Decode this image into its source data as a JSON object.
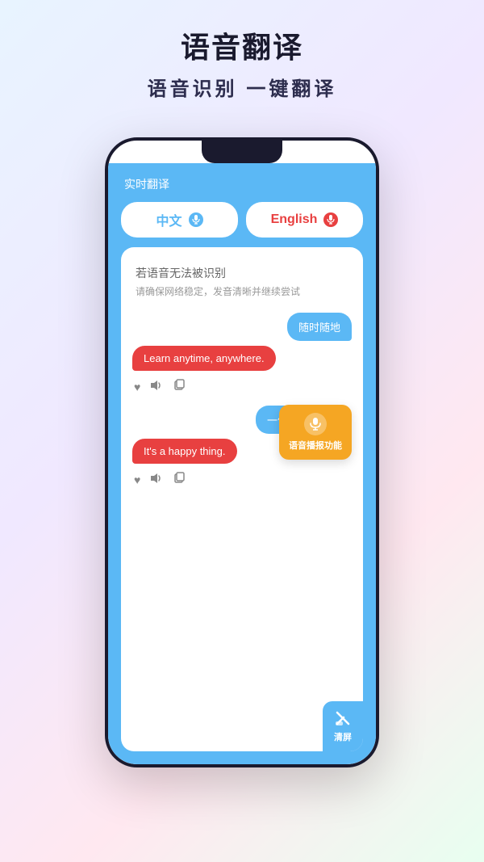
{
  "header": {
    "title": "语音翻译",
    "subtitle": "语音识别 一键翻译"
  },
  "phone": {
    "appTitle": "实时翻译",
    "languages": {
      "chinese": "中文",
      "english": "English"
    },
    "statusMessage": {
      "title": "若语音无法被识别",
      "subtitle": "请确保网络稳定，发音清晰并继续尝试"
    },
    "conversations": [
      {
        "rightBubble": "随时随地",
        "leftBubble": "Learn anytime, anywhere."
      },
      {
        "rightBubble": "一件快乐的事。",
        "leftBubble": "It's a happy thing."
      }
    ],
    "tooltip": {
      "text": "语音播报功能"
    },
    "clearBtn": "清屏"
  },
  "icons": {
    "mic": "mic-icon",
    "heart": "♥",
    "volume": "🔈",
    "copy": "⊕",
    "brush": "🧹"
  },
  "colors": {
    "blue": "#5bb8f5",
    "red": "#e84040",
    "orange": "#f5a623",
    "white": "#ffffff",
    "darkBg": "#1a1a2e"
  }
}
